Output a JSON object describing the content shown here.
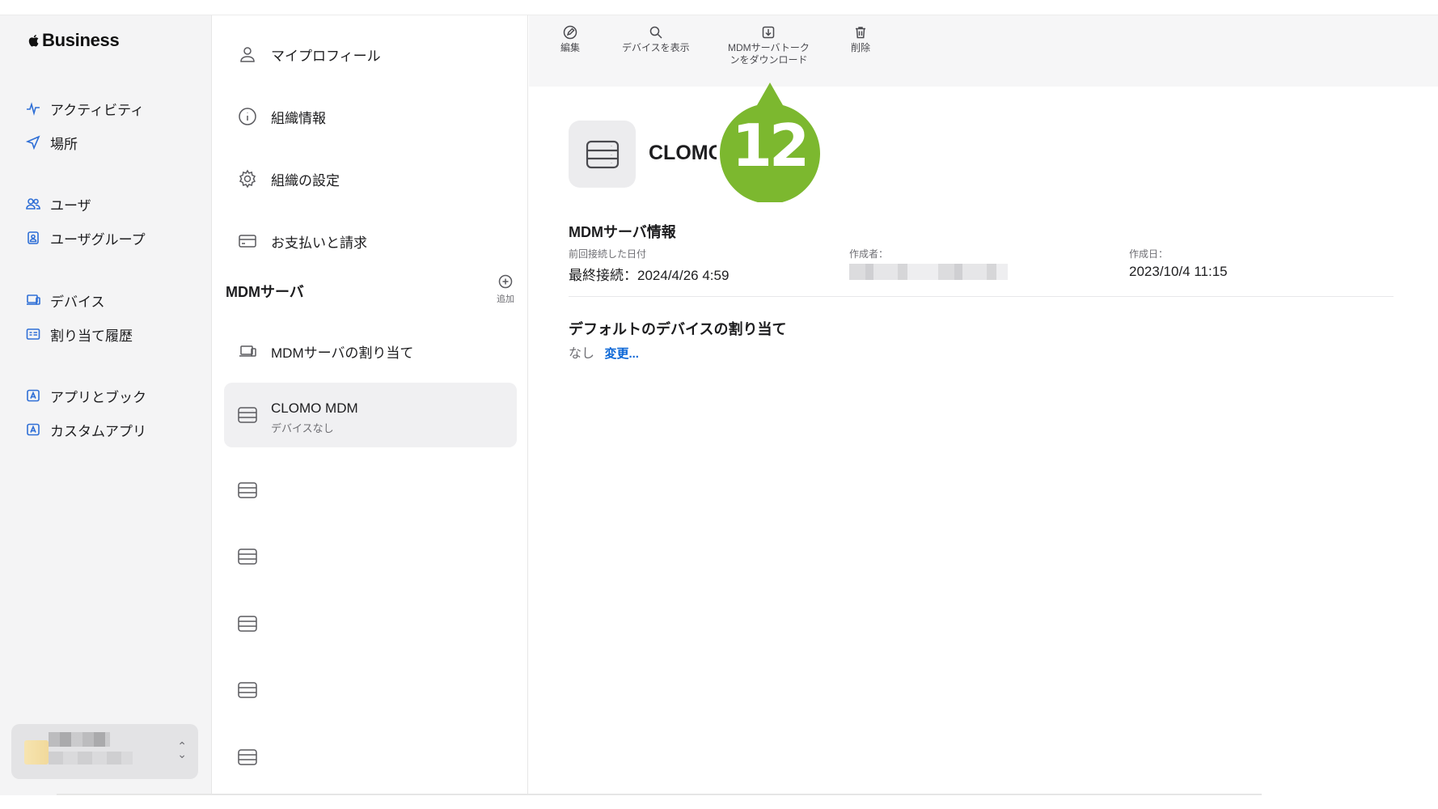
{
  "brand": {
    "logo_text": "Business"
  },
  "sidebar": {
    "groups": [
      [
        {
          "label": "アクティビティ",
          "icon": "activity-icon"
        },
        {
          "label": "場所",
          "icon": "location-icon"
        }
      ],
      [
        {
          "label": "ユーザ",
          "icon": "users-icon"
        },
        {
          "label": "ユーザグループ",
          "icon": "user-group-icon"
        }
      ],
      [
        {
          "label": "デバイス",
          "icon": "devices-icon"
        },
        {
          "label": "割り当て履歴",
          "icon": "assignment-history-icon"
        }
      ],
      [
        {
          "label": "アプリとブック",
          "icon": "apps-books-icon"
        },
        {
          "label": "カスタムアプリ",
          "icon": "custom-apps-icon"
        }
      ]
    ]
  },
  "settings_menu": {
    "items": [
      {
        "label": "マイプロフィール",
        "icon": "person-icon"
      },
      {
        "label": "組織情報",
        "icon": "info-icon"
      },
      {
        "label": "組織の設定",
        "icon": "gear-icon"
      },
      {
        "label": "お支払いと請求",
        "icon": "credit-card-icon"
      }
    ],
    "mdm_section_title": "MDMサーバ",
    "add_label": "追加",
    "mdm_assign_label": "MDMサーバの割り当て",
    "selected_server": {
      "name": "CLOMO MDM",
      "subtitle": "デバイスなし"
    }
  },
  "toolbar": {
    "edit": "編集",
    "show_devices": "デバイスを表示",
    "download_token_line1": "MDMサーバトーク",
    "download_token_line2": "ンをダウンロード",
    "delete": "削除"
  },
  "detail": {
    "title": "CLOMO MDM",
    "info_title": "MDMサーバ情報",
    "last_connected_label": "前回接続した日付",
    "last_connected_value": "最終接続：2024/4/26 4:59",
    "created_by_label": "作成者：",
    "created_date_label": "作成日：",
    "created_date_value": "2023/10/4 11:15",
    "default_assign_title": "デフォルトのデバイスの割り当て",
    "default_assign_value": "なし",
    "change_link": "変更..."
  },
  "callout": {
    "number": "12",
    "color": "#7cb82f"
  }
}
